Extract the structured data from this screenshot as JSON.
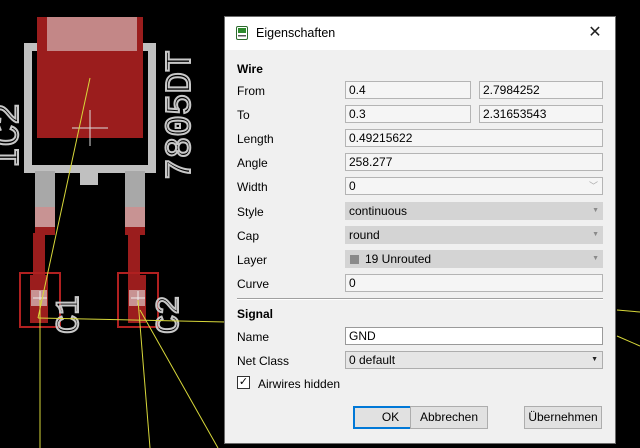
{
  "pcb": {
    "parts": [
      {
        "name": "IC2"
      },
      {
        "value": "7805DT"
      },
      {
        "name": "C1"
      },
      {
        "name": "C2"
      }
    ]
  },
  "dialog": {
    "title": "Eigenschaften",
    "wire": {
      "section_label": "Wire",
      "from_label": "From",
      "from_x": "0.4",
      "from_y": "2.7984252",
      "to_label": "To",
      "to_x": "0.3",
      "to_y": "2.31653543",
      "length_label": "Length",
      "length": "0.49215622",
      "angle_label": "Angle",
      "angle": "258.277",
      "width_label": "Width",
      "width": "0",
      "style_label": "Style",
      "style": "continuous",
      "cap_label": "Cap",
      "cap": "round",
      "layer_label": "Layer",
      "layer": "19 Unrouted",
      "curve_label": "Curve",
      "curve": "0"
    },
    "signal": {
      "section_label": "Signal",
      "name_label": "Name",
      "name": "GND",
      "netclass_label": "Net Class",
      "netclass": "0 default",
      "airwires_label": "Airwires hidden",
      "airwires_hidden": true
    },
    "buttons": {
      "ok": "OK",
      "cancel": "Abbrechen",
      "apply": "Übernehmen"
    }
  },
  "colors": {
    "pad_red": "#9b1d1d",
    "silk_grey": "#c0c0c0",
    "airwire_yellow": "#d8d83a"
  }
}
